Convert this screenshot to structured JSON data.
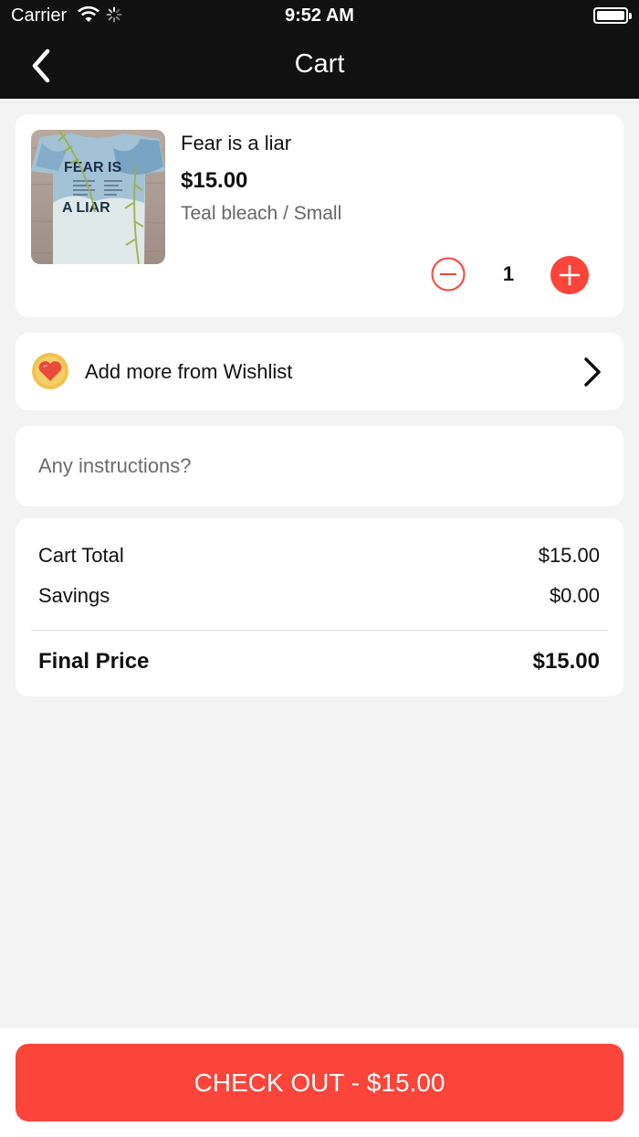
{
  "status_bar": {
    "carrier": "Carrier",
    "time": "9:52 AM"
  },
  "nav": {
    "title": "Cart",
    "back_icon": "chevron-left-icon"
  },
  "cart_item": {
    "name": "Fear is a liar",
    "price": "$15.00",
    "variant": "Teal bleach / Small",
    "quantity": "1",
    "image_text": [
      "FEAR IS",
      "A LIAR"
    ]
  },
  "wishlist": {
    "label": "Add more from Wishlist",
    "icon": "heart-icon"
  },
  "instructions": {
    "placeholder": "Any instructions?",
    "value": ""
  },
  "summary": {
    "cart_total_label": "Cart Total",
    "cart_total_value": "$15.00",
    "savings_label": "Savings",
    "savings_value": "$0.00",
    "final_label": "Final Price",
    "final_value": "$15.00"
  },
  "checkout": {
    "label": "CHECK OUT - $15.00"
  },
  "colors": {
    "accent": "#fb443a",
    "header": "#111111",
    "background": "#f3f3f3"
  }
}
